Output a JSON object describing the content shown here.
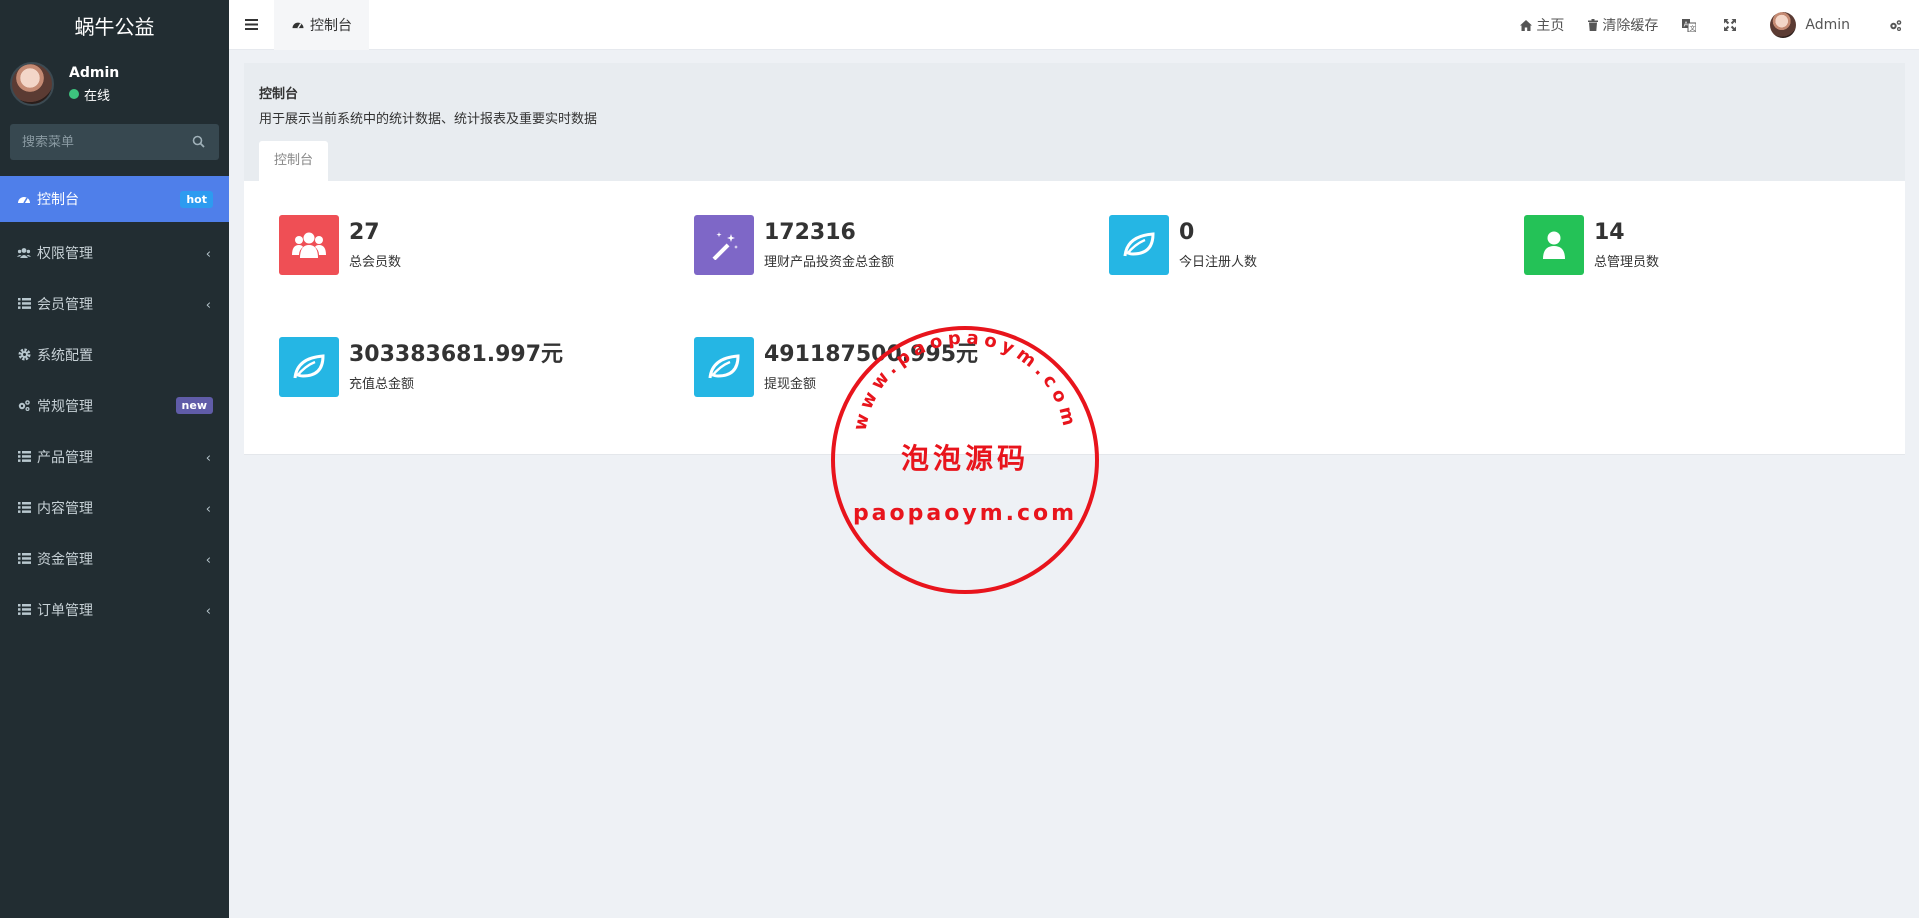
{
  "app": {
    "brand": "蜗牛公益"
  },
  "user": {
    "name": "Admin",
    "status": "在线"
  },
  "search": {
    "placeholder": "搜索菜单"
  },
  "sidebar": {
    "items": [
      {
        "label": "控制台",
        "icon": "dashboard-icon",
        "badge": "hot",
        "active": true
      },
      {
        "label": "权限管理",
        "icon": "group-icon",
        "chevron": true
      },
      {
        "label": "会员管理",
        "icon": "list-icon",
        "chevron": true
      },
      {
        "label": "系统配置",
        "icon": "gear-icon"
      },
      {
        "label": "常规管理",
        "icon": "gears-icon",
        "badge": "new"
      },
      {
        "label": "产品管理",
        "icon": "list-icon",
        "chevron": true
      },
      {
        "label": "内容管理",
        "icon": "list-icon",
        "chevron": true
      },
      {
        "label": "资金管理",
        "icon": "list-icon",
        "chevron": true
      },
      {
        "label": "订单管理",
        "icon": "list-icon",
        "chevron": true
      }
    ]
  },
  "header": {
    "tab": "控制台",
    "home": "主页",
    "clear_cache": "清除缓存",
    "user": "Admin"
  },
  "panel": {
    "title": "控制台",
    "description": "用于展示当前系统中的统计数据、统计报表及重要实时数据",
    "tab": "控制台"
  },
  "stats": [
    {
      "value": "27",
      "label": "总会员数",
      "color": "#ef4f55",
      "icon": "users-icon"
    },
    {
      "value": "172316",
      "label": "理财产品投资金总金额",
      "color": "#7e67c7",
      "icon": "magic-wand-icon"
    },
    {
      "value": "0",
      "label": "今日注册人数",
      "color": "#25b6e4",
      "icon": "leaf-icon"
    },
    {
      "value": "14",
      "label": "总管理员数",
      "color": "#24c257",
      "icon": "user-icon"
    },
    {
      "value": "303383681.997元",
      "label": "充值总金额",
      "color": "#25b6e4",
      "icon": "leaf-icon"
    },
    {
      "value": "491187500.995元",
      "label": "提现金额",
      "color": "#25b6e4",
      "icon": "leaf-icon"
    }
  ],
  "watermark": {
    "arc_text": "www.paopaoym.com",
    "center_text": "泡泡源码",
    "bottom_text": "paopaoym.com",
    "color": "#e8141c"
  }
}
